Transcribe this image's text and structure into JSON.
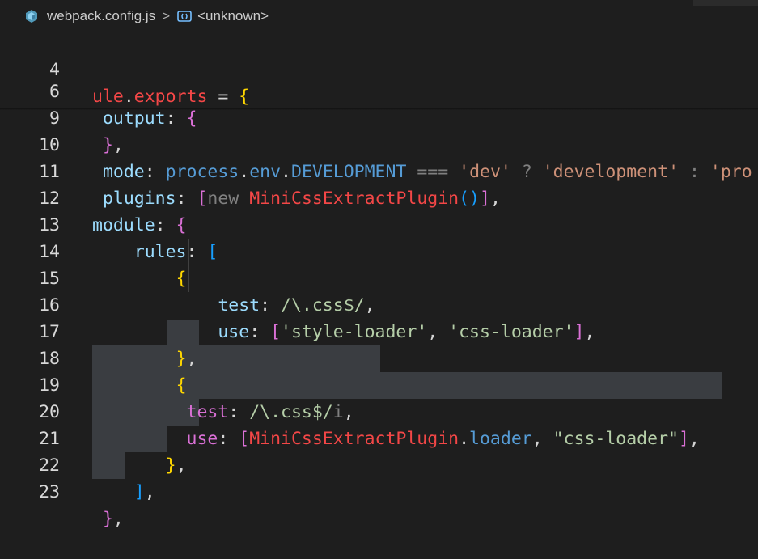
{
  "breadcrumb": {
    "file_name": "webpack.config.js",
    "separator": ">",
    "symbol": "<unknown>",
    "file_icon": "cube-icon",
    "symbol_icon": "symbol-namespace-icon"
  },
  "code_lines": [
    {
      "n": "4",
      "text": "ule.exports = {"
    },
    {
      "n": "6",
      "text": " output: {"
    },
    {
      "n": "9",
      "text": " },"
    },
    {
      "n": "10",
      "text": " mode: process.env.DEVELOPMENT === 'dev' ? 'development' : 'pro"
    },
    {
      "n": "11",
      "text": " plugins: [new MiniCssExtractPlugin()],"
    },
    {
      "n": "12",
      "text": "module: {"
    },
    {
      "n": "13",
      "text": "    rules: ["
    },
    {
      "n": "14",
      "text": "        {"
    },
    {
      "n": "15",
      "text": "            test: /\\.css$/,"
    },
    {
      "n": "16",
      "text": "            use: ['style-loader', 'css-loader'],"
    },
    {
      "n": "17",
      "text": "        },"
    },
    {
      "n": "18",
      "text": "        {"
    },
    {
      "n": "19",
      "text": "         test: /\\.css$/i,"
    },
    {
      "n": "20",
      "text": "         use: [MiniCssExtractPlugin.loader, \"css-loader\"],"
    },
    {
      "n": "21",
      "text": "        },"
    },
    {
      "n": "22",
      "text": "     ],"
    },
    {
      "n": "23",
      "text": " },"
    }
  ],
  "colors": {
    "background": "#1e1e1e",
    "selection": "#3a3d41",
    "keyword": "#569cd6",
    "property": "#9cdcfe",
    "string": "#ce9178",
    "regex": "#b5cea8",
    "bracket_yellow": "#ffd700",
    "bracket_magenta": "#da70d6",
    "bracket_blue": "#179fff"
  }
}
